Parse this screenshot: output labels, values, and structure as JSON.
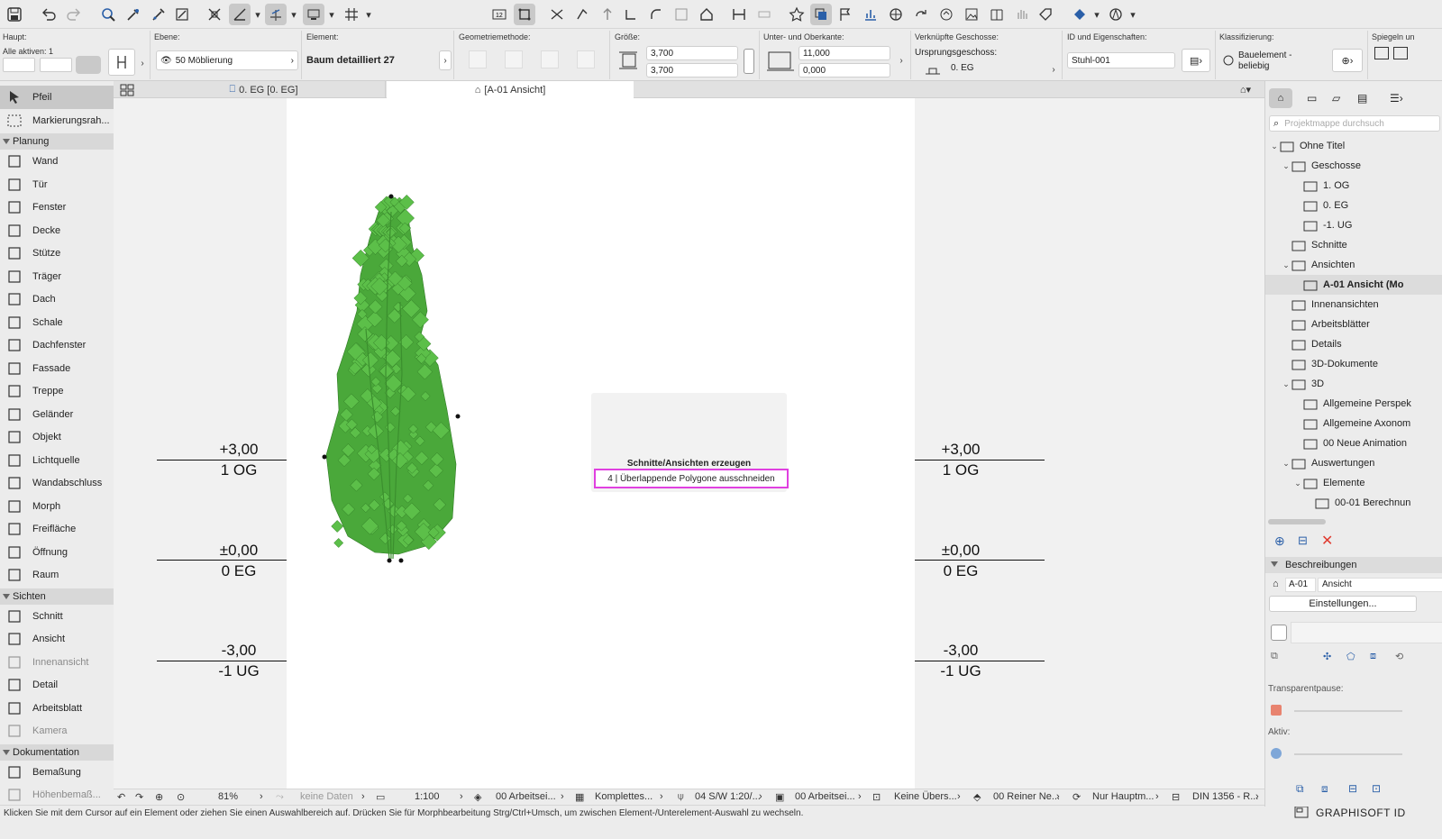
{
  "infobox": {
    "haupt_label": "Haupt:",
    "alle_aktiven": "Alle aktiven: 1",
    "ebene_label": "Ebene:",
    "ebene_value": "50 Möblierung",
    "element_label": "Element:",
    "element_value": "Baum detailliert 27",
    "geometrie_label": "Geometriemethode:",
    "groesse_label": "Größe:",
    "groesse_a": "3,700",
    "groesse_b": "3,700",
    "kante_label": "Unter- und Oberkante:",
    "kante_top": "11,000",
    "kante_bottom": "0,000",
    "geschosse_label": "Verknüpfte Geschosse:",
    "ursprung_label": "Ursprungsgeschoss:",
    "ursprung_value": "0. EG",
    "id_label": "ID und Eigenschaften:",
    "id_value": "Stuhl-001",
    "klass_label": "Klassifizierung:",
    "klass_value_1": "Bauelement -",
    "klass_value_2": "beliebig",
    "spiegeln_label": "Spiegeln un"
  },
  "toolbox": {
    "items": [
      {
        "label": "Pfeil"
      },
      {
        "label": "Markierungsrah..."
      }
    ],
    "planung_label": "Planung",
    "planung": [
      {
        "label": "Wand"
      },
      {
        "label": "Tür"
      },
      {
        "label": "Fenster"
      },
      {
        "label": "Decke"
      },
      {
        "label": "Stütze"
      },
      {
        "label": "Träger"
      },
      {
        "label": "Dach"
      },
      {
        "label": "Schale"
      },
      {
        "label": "Dachfenster"
      },
      {
        "label": "Fassade"
      },
      {
        "label": "Treppe"
      },
      {
        "label": "Geländer"
      },
      {
        "label": "Objekt"
      },
      {
        "label": "Lichtquelle"
      },
      {
        "label": "Wandabschluss"
      },
      {
        "label": "Morph"
      },
      {
        "label": "Freifläche"
      },
      {
        "label": "Öffnung"
      },
      {
        "label": "Raum"
      }
    ],
    "sichten_label": "Sichten",
    "sichten": [
      {
        "label": "Schnitt"
      },
      {
        "label": "Ansicht"
      },
      {
        "label": "Innenansicht"
      },
      {
        "label": "Detail"
      },
      {
        "label": "Arbeitsblatt"
      },
      {
        "label": "Kamera"
      }
    ],
    "dokumentation_label": "Dokumentation",
    "dokumentation": [
      {
        "label": "Bemaßung"
      },
      {
        "label": "Höhenbemaß..."
      }
    ]
  },
  "tabs": [
    {
      "label": "0. EG [0. EG]"
    },
    {
      "label": "[A-01 Ansicht]"
    }
  ],
  "canvas": {
    "levels_left": [
      {
        "value": "+3,00",
        "name": "1 OG"
      },
      {
        "value": "±0,00",
        "name": "0 EG"
      },
      {
        "value": "-3,00",
        "name": "-1 UG"
      }
    ],
    "levels_right": [
      {
        "value": "+3,00",
        "name": "1 OG"
      },
      {
        "value": "±0,00",
        "name": "0 EG"
      },
      {
        "value": "-3,00",
        "name": "-1 UG"
      }
    ],
    "popup_title": "Schnitte/Ansichten erzeugen",
    "popup_step": "4 | Überlappende Polygone ausschneiden"
  },
  "statusbar": {
    "zoom": "81%",
    "undo_data": "keine Daten",
    "scale": "1:100",
    "layer": "00 Arbeitsei...",
    "pens": "Komplettes...",
    "model": "04 S/W 1:20/...",
    "view": "00 Arbeitsei...",
    "override": "Keine Übers...",
    "renovation": "00 Reiner Ne...",
    "structure": "Nur Hauptm...",
    "dim": "DIN 1356 - R..."
  },
  "hint": "Klicken Sie mit dem Cursor auf ein Element oder ziehen Sie einen Auswahlbereich auf. Drücken Sie für Morphbearbeitung Strg/Ctrl+Umsch, um zwischen Element-/Unterelement-Auswahl zu wechseln.",
  "navigator": {
    "search_placeholder": "Projektmappe durchsuch",
    "tree": [
      {
        "label": "Ohne Titel"
      },
      {
        "label": "Geschosse"
      },
      {
        "label": "1. OG"
      },
      {
        "label": "0. EG"
      },
      {
        "label": "-1. UG"
      },
      {
        "label": "Schnitte"
      },
      {
        "label": "Ansichten"
      },
      {
        "label": "A-01 Ansicht (Mo"
      },
      {
        "label": "Innenansichten"
      },
      {
        "label": "Arbeitsblätter"
      },
      {
        "label": "Details"
      },
      {
        "label": "3D-Dokumente"
      },
      {
        "label": "3D"
      },
      {
        "label": "Allgemeine Perspek"
      },
      {
        "label": "Allgemeine Axonom"
      },
      {
        "label": "00 Neue Animation"
      },
      {
        "label": "Auswertungen"
      },
      {
        "label": "Elemente"
      },
      {
        "label": "00-01 Berechnun"
      }
    ],
    "beschreibungen_label": "Beschreibungen",
    "desc_id": "A-01",
    "desc_name": "Ansicht",
    "einstellungen": "Einstellungen...",
    "transparent_label": "Transparentpause:",
    "aktiv_label": "Aktiv:"
  },
  "brand": "GRAPHISOFT ID"
}
